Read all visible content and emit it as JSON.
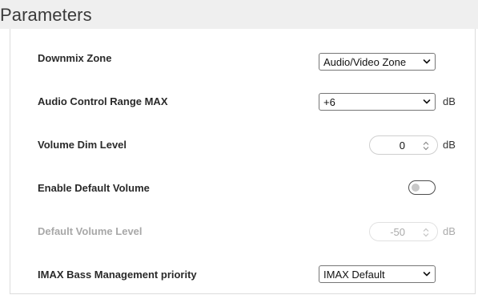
{
  "header": {
    "title": "Parameters"
  },
  "params": {
    "downmix_zone": {
      "label": "Downmix Zone",
      "value": "Audio/Video Zone",
      "icon": "chevron-down-icon"
    },
    "audio_control_range_max": {
      "label": "Audio Control Range MAX",
      "value": "+6",
      "unit": "dB",
      "icon": "chevron-down-icon"
    },
    "volume_dim_level": {
      "label": "Volume Dim Level",
      "value": "0",
      "unit": "dB",
      "icon": "spinner-arrows-icon"
    },
    "enable_default_volume": {
      "label": "Enable Default Volume",
      "state": "off"
    },
    "default_volume_level": {
      "label": "Default Volume Level",
      "value": "-50",
      "unit": "dB",
      "disabled": true,
      "icon": "spinner-arrows-icon"
    },
    "imax_bass_management_priority": {
      "label": "IMAX Bass Management priority",
      "value": "IMAX Default",
      "icon": "chevron-down-icon"
    }
  }
}
